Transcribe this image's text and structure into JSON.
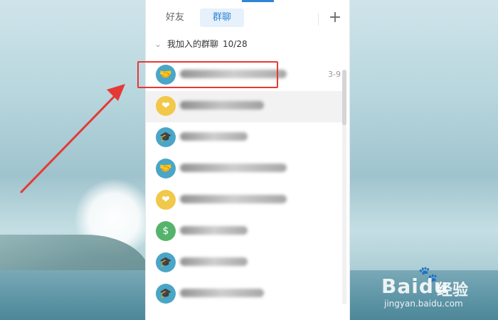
{
  "tabs": [
    {
      "label": "好友",
      "active": false
    },
    {
      "label": "群聊",
      "active": true
    }
  ],
  "add_icon": "plus",
  "section": {
    "label": "我加入的群聊",
    "count": "10/28",
    "expanded": true
  },
  "groups": [
    {
      "avatar_icon": "handshake-icon",
      "avatar_color": "#4aa6c7",
      "time": "3-9",
      "highlighted": true
    },
    {
      "avatar_icon": "heart-icon",
      "avatar_color": "#f2c84b",
      "time": "",
      "hover": true
    },
    {
      "avatar_icon": "graduation-cap-icon",
      "avatar_color": "#4aa6c7",
      "time": ""
    },
    {
      "avatar_icon": "handshake-icon",
      "avatar_color": "#4aa6c7",
      "time": ""
    },
    {
      "avatar_icon": "heart-icon",
      "avatar_color": "#f2c84b",
      "time": ""
    },
    {
      "avatar_icon": "money-bag-icon",
      "avatar_color": "#56b36b",
      "time": ""
    },
    {
      "avatar_icon": "graduation-cap-icon",
      "avatar_color": "#4aa6c7",
      "time": ""
    },
    {
      "avatar_icon": "graduation-cap-icon",
      "avatar_color": "#4aa6c7",
      "time": ""
    }
  ],
  "annotation": {
    "highlight_color": "#e53935",
    "arrow_color": "#e53935"
  },
  "watermark": {
    "logo": "Baidu",
    "cn": "经验",
    "url": "jingyan.baidu.com"
  },
  "colors": {
    "accent": "#2f86d6"
  }
}
